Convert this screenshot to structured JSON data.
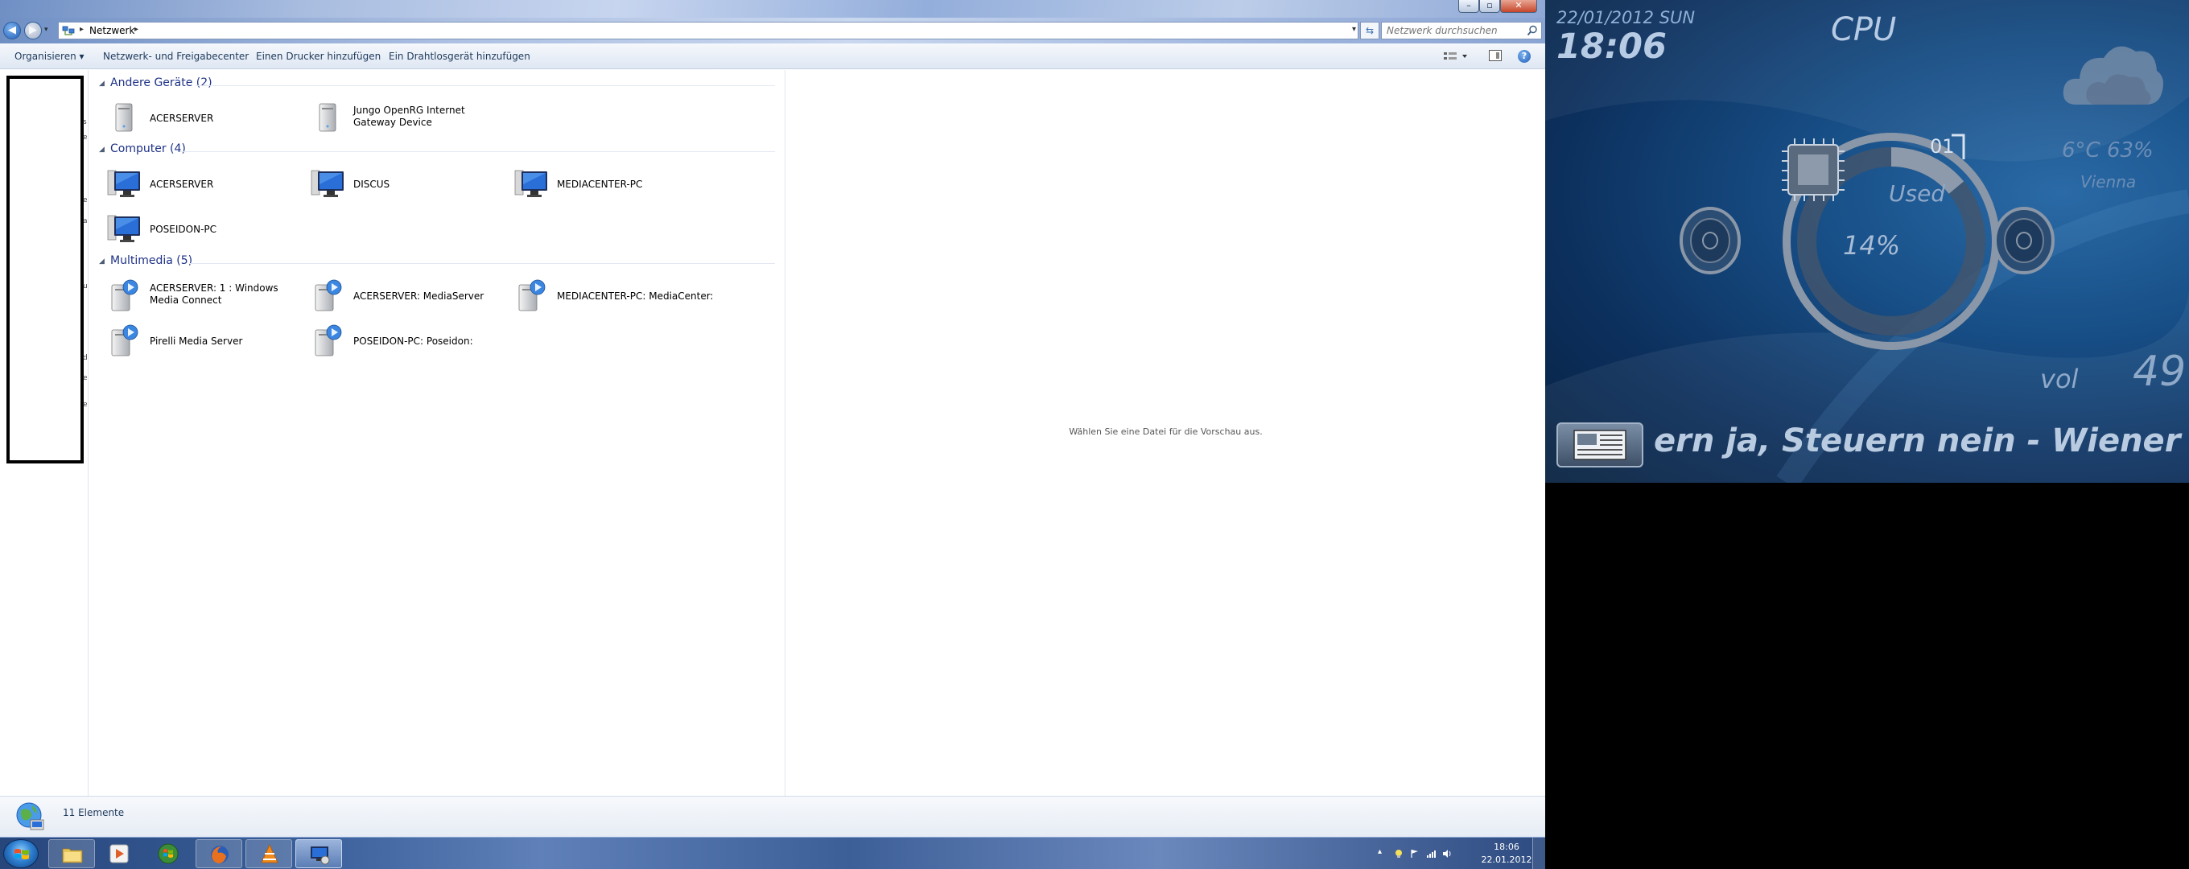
{
  "window": {
    "controls": {
      "minimize": "–",
      "maximize": "▫",
      "close": "✕"
    }
  },
  "address": {
    "path": "Netzwerk",
    "search_placeholder": "Netzwerk durchsuchen"
  },
  "toolbar": {
    "organize": "Organisieren ▾",
    "network_center": "Netzwerk- und Freigabecenter",
    "add_printer": "Einen Drucker hinzufügen",
    "add_wireless": "Ein Drahtlosgerät hinzufügen",
    "help": "?"
  },
  "nav_fragments": [
    "s",
    "e",
    "e",
    "a",
    "u",
    "d",
    "e",
    "e"
  ],
  "groups": [
    {
      "title": "Andere Geräte (2)",
      "items": [
        {
          "label": "ACERSERVER",
          "icon": "media-device-icon"
        },
        {
          "label": "Jungo OpenRG Internet Gateway Device",
          "icon": "gateway-device-icon"
        }
      ]
    },
    {
      "title": "Computer (4)",
      "items": [
        {
          "label": "ACERSERVER",
          "icon": "computer-icon"
        },
        {
          "label": "DISCUS",
          "icon": "computer-icon"
        },
        {
          "label": "MEDIACENTER-PC",
          "icon": "computer-icon"
        },
        {
          "label": "POSEIDON-PC",
          "icon": "computer-icon"
        }
      ]
    },
    {
      "title": "Multimedia (5)",
      "items": [
        {
          "label": "ACERSERVER: 1 : Windows Media Connect",
          "icon": "media-server-icon"
        },
        {
          "label": "ACERSERVER: MediaServer",
          "icon": "media-server-icon"
        },
        {
          "label": "MEDIACENTER-PC: MediaCenter:",
          "icon": "media-server-icon"
        },
        {
          "label": "Pirelli Media Server",
          "icon": "media-server-icon"
        },
        {
          "label": "POSEIDON-PC: Poseidon:",
          "icon": "media-server-icon"
        }
      ]
    }
  ],
  "preview": {
    "text": "Wählen Sie eine Datei für die Vorschau aus."
  },
  "status": {
    "text": "11 Elemente"
  },
  "taskbar": {
    "clock_time": "18:06",
    "clock_date": "22.01.2012"
  },
  "widget": {
    "date": "22/01/2012 SUN",
    "time": "18:06",
    "cpu_label": "CPU",
    "cpu_core": "01",
    "cpu_used_label": "Used",
    "cpu_percent": "14%",
    "cpu_usage_fraction": 0.14,
    "weather_temp": "6°C  63%",
    "weather_city": "Vienna",
    "vol_label": "vol",
    "vol_value": "49",
    "ticker": "ern ja, Steuern nein - Wiener Ze"
  },
  "colors": {
    "group_title": "#1e3287",
    "toolbar_text": "#1e395b",
    "widget_text": "#b7cbe4"
  }
}
